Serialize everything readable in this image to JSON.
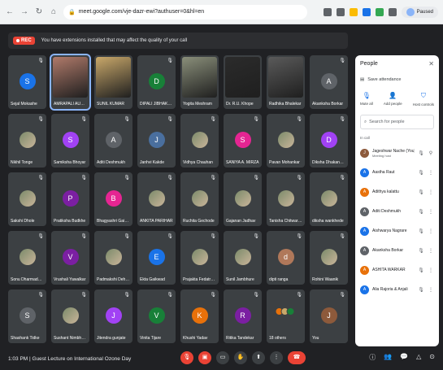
{
  "browser": {
    "url": "meet.google.com/vje-dazr-ewi?authuser=0&hl=en",
    "profile_label": "Paused"
  },
  "meet": {
    "rec_label": "REC",
    "warning": "You have extensions installed that may affect the quality of your call",
    "tiles": [
      {
        "name": "Sejal Mokashe",
        "letter": "S",
        "color": "#1a73e8",
        "kind": "avatar"
      },
      {
        "name": "AMRAPALI AUSKAR",
        "letter": "",
        "color": "#b07a6a",
        "kind": "video",
        "pinned": true
      },
      {
        "name": "SUNIL KUMAR",
        "letter": "",
        "color": "#c9a86a",
        "kind": "video"
      },
      {
        "name": "DIPALI JIBHAKATE",
        "letter": "D",
        "color": "#188038",
        "kind": "avatar"
      },
      {
        "name": "Yogita Meshram",
        "letter": "",
        "color": "#8a8f7a",
        "kind": "video"
      },
      {
        "name": "Dr. R.U. Khope",
        "letter": "",
        "color": "#2b2b2b",
        "kind": "video"
      },
      {
        "name": "Radhika Bhalekar",
        "letter": "",
        "color": "#5a5a5a",
        "kind": "video"
      },
      {
        "name": "Akanksha Borkar",
        "letter": "A",
        "color": "#5f6368",
        "kind": "avatar"
      },
      {
        "name": "Nikhil Tonge",
        "letter": "",
        "color": "",
        "kind": "photo"
      },
      {
        "name": "Samiksha Bhoyar",
        "letter": "S",
        "color": "#a142f4",
        "kind": "avatar"
      },
      {
        "name": "Aditi Deshmukh",
        "letter": "A",
        "color": "#5f6368",
        "kind": "avatar"
      },
      {
        "name": "Janhvi Kakde",
        "letter": "J",
        "color": "#4a6f9e",
        "kind": "avatar"
      },
      {
        "name": "Vidhya Chauhan",
        "letter": "",
        "color": "",
        "kind": "photo"
      },
      {
        "name": "SANIYA A. MIRZA",
        "letter": "S",
        "color": "#e52592",
        "kind": "avatar"
      },
      {
        "name": "Pavan Mohankar",
        "letter": "",
        "color": "",
        "kind": "photo"
      },
      {
        "name": "Diksha Dhakane ...",
        "letter": "D",
        "color": "#a142f4",
        "kind": "avatar"
      },
      {
        "name": "Sakshi Dhole",
        "letter": "",
        "color": "",
        "kind": "photo"
      },
      {
        "name": "Pratiksha Budkhe",
        "letter": "P",
        "color": "#7b1fa2",
        "kind": "avatar"
      },
      {
        "name": "Bhagyashri Gaikwad",
        "letter": "B",
        "color": "#e52592",
        "kind": "avatar"
      },
      {
        "name": "ANKITA PARIHAR",
        "letter": "",
        "color": "",
        "kind": "photo"
      },
      {
        "name": "Ruchita Gechode",
        "letter": "",
        "color": "",
        "kind": "photo"
      },
      {
        "name": "Gajanan Jadhav",
        "letter": "",
        "color": "",
        "kind": "photo"
      },
      {
        "name": "Tanisha Chitwaren",
        "letter": "",
        "color": "",
        "kind": "photo"
      },
      {
        "name": "diksha wankhede",
        "letter": "",
        "color": "",
        "kind": "photo"
      },
      {
        "name": "Sonu Dharmadhikari",
        "letter": "",
        "color": "",
        "kind": "photo"
      },
      {
        "name": "Vrushali Yawalkar",
        "letter": "V",
        "color": "#7b1fa2",
        "kind": "avatar"
      },
      {
        "name": "Padmakshi Dehury",
        "letter": "",
        "color": "",
        "kind": "photo"
      },
      {
        "name": "Ekta Gaikwad",
        "letter": "E",
        "color": "#1a73e8",
        "kind": "avatar"
      },
      {
        "name": "Prajakta Fedatrawar",
        "letter": "",
        "color": "",
        "kind": "photo"
      },
      {
        "name": "Sunil Jambhure",
        "letter": "",
        "color": "",
        "kind": "photo"
      },
      {
        "name": "dipti ranga",
        "letter": "d",
        "color": "#b0785a",
        "kind": "avatar"
      },
      {
        "name": "Rohini Waanik",
        "letter": "",
        "color": "",
        "kind": "photo"
      },
      {
        "name": "Shashank Tidke",
        "letter": "S",
        "color": "#5f6368",
        "kind": "avatar"
      },
      {
        "name": "Sushant Nimbhorkar",
        "letter": "",
        "color": "",
        "kind": "photo"
      },
      {
        "name": "Jitendra gunjate",
        "letter": "J",
        "color": "#a142f4",
        "kind": "avatar"
      },
      {
        "name": "Vinita Tijare",
        "letter": "V",
        "color": "#188038",
        "kind": "avatar"
      },
      {
        "name": "Khushi Yadav",
        "letter": "K",
        "color": "#e8710a",
        "kind": "avatar"
      },
      {
        "name": "Ritika Tandekar",
        "letter": "R",
        "color": "#7b1fa2",
        "kind": "avatar"
      },
      {
        "name": "18 others",
        "letter": "",
        "color": "",
        "kind": "others"
      },
      {
        "name": "You",
        "letter": "J",
        "color": "#8d5a3b",
        "kind": "avatar"
      }
    ]
  },
  "bottom": {
    "meeting_info": "1:03 PM | Guest Lecture on International Ozone Day"
  },
  "people": {
    "title": "People",
    "save_attendance": "Save attendance",
    "actions": [
      "Mute all",
      "Add people",
      "Host controls"
    ],
    "search_placeholder": "Search for people",
    "section": "In call",
    "list": [
      {
        "name": "Jageshwar Nache (You)",
        "sub": "Meeting host",
        "letter": "J",
        "color": "#8d5a3b"
      },
      {
        "name": "Aastha Raut",
        "sub": "",
        "letter": "A",
        "color": "#1a73e8"
      },
      {
        "name": "Adithya kalattu",
        "sub": "",
        "letter": "A",
        "color": "#e8710a"
      },
      {
        "name": "Aditi Deshmukh",
        "sub": "",
        "letter": "A",
        "color": "#5f6368"
      },
      {
        "name": "Aishwarya Nagrare",
        "sub": "",
        "letter": "A",
        "color": "#1a73e8"
      },
      {
        "name": "Akanksha Borkar",
        "sub": "",
        "letter": "A",
        "color": "#5f6368"
      },
      {
        "name": "ASHITA WARKAR",
        "sub": "",
        "letter": "A",
        "color": "#e8710a"
      },
      {
        "name": "Alia Rajoria & Anjali",
        "sub": "",
        "letter": "A",
        "color": "#1a73e8"
      }
    ]
  }
}
